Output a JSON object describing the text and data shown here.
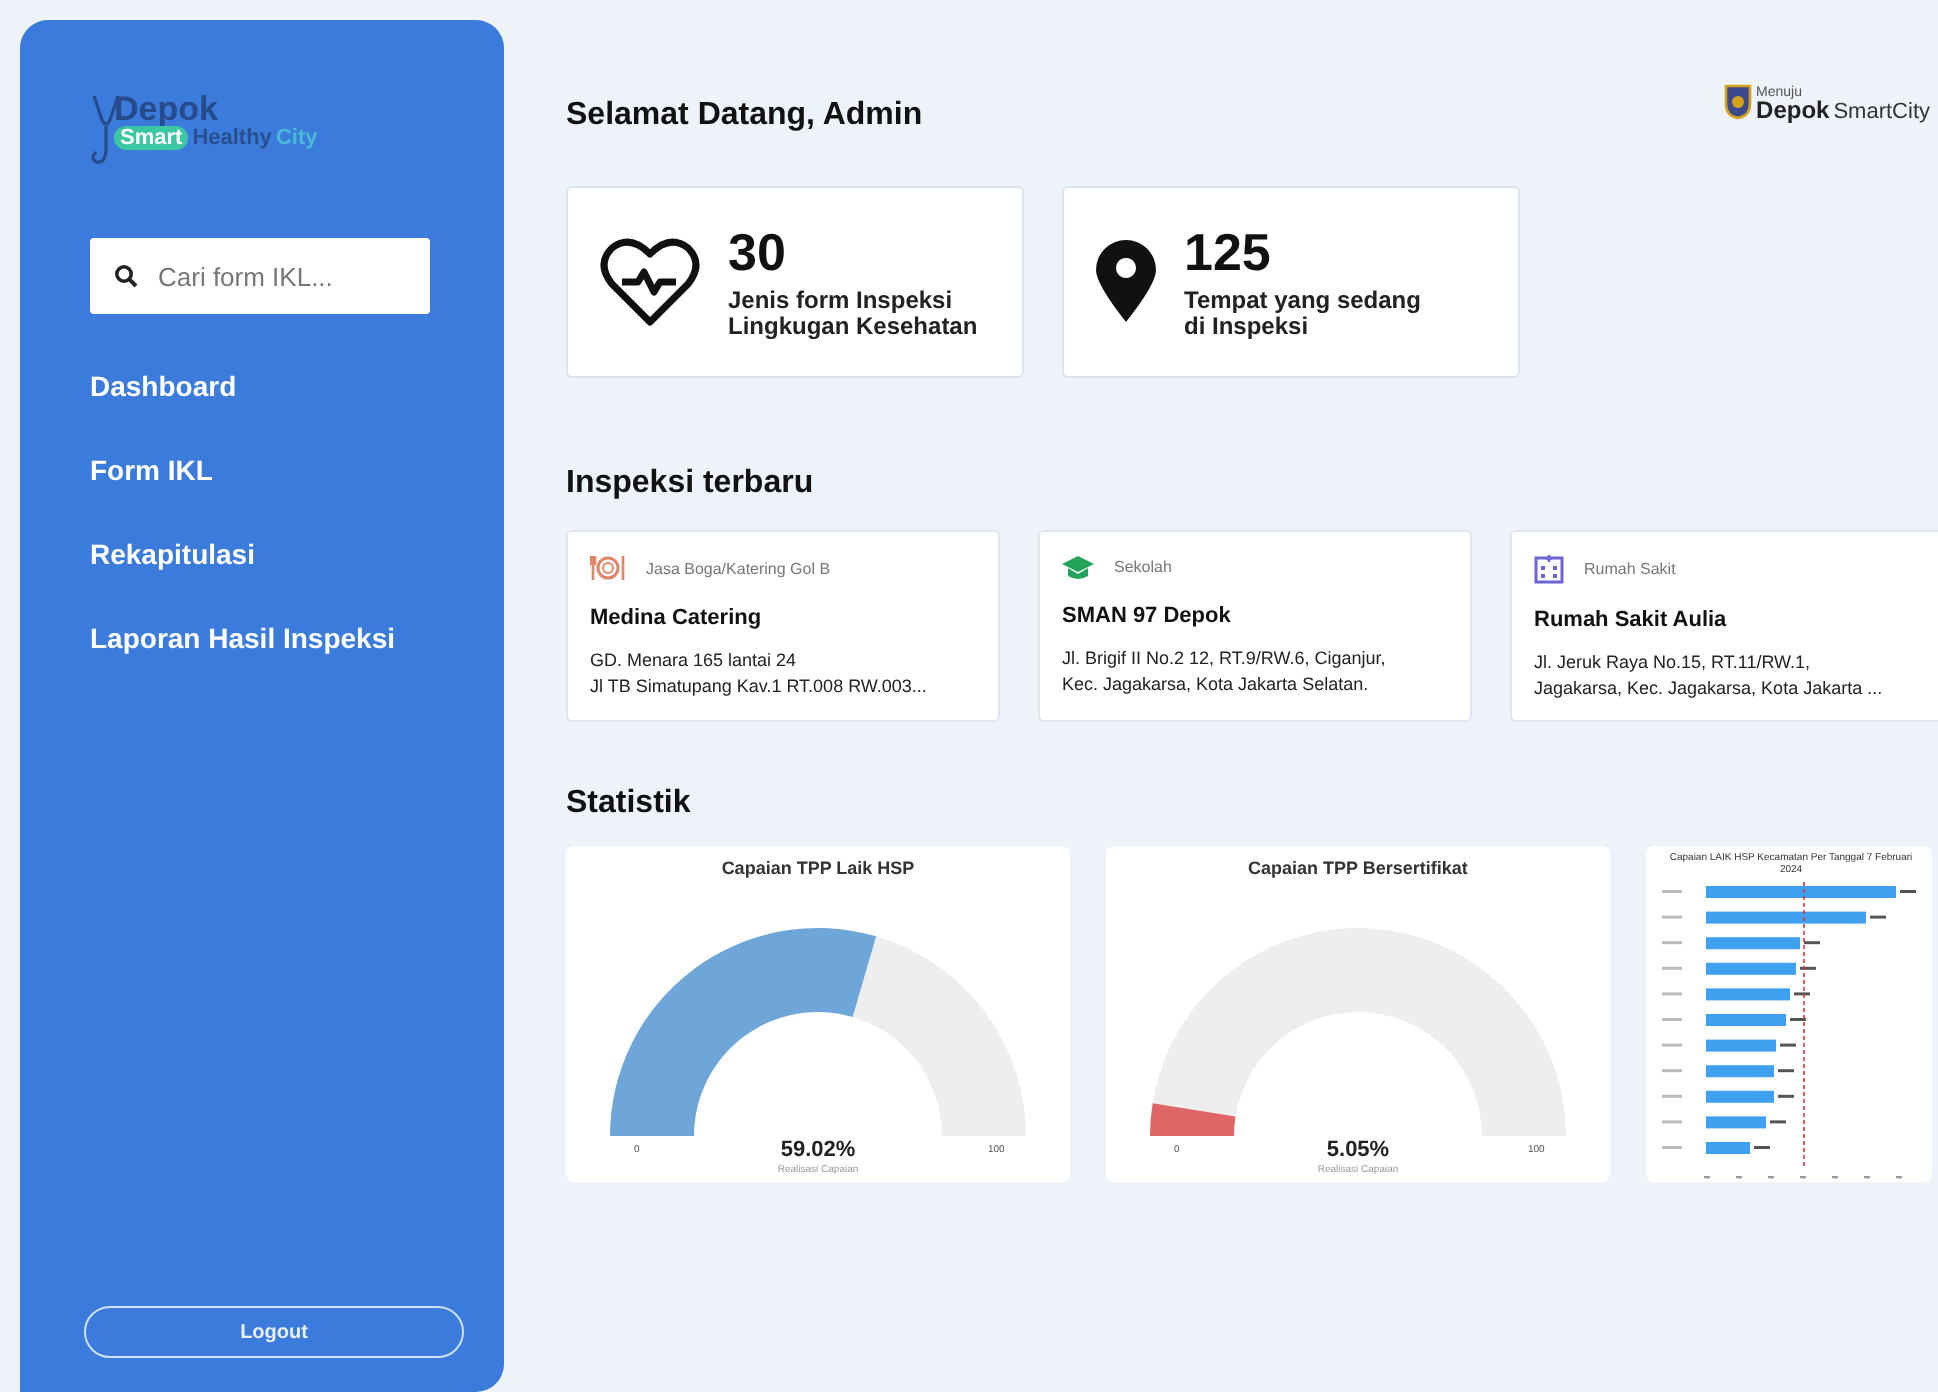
{
  "sidebar": {
    "logo": {
      "word_1": "Depok",
      "word_2": "Smart",
      "word_3": "Healthy",
      "word_4": "City"
    },
    "search": {
      "placeholder": "Cari form IKL..."
    },
    "nav_items": [
      {
        "label": "Dashboard"
      },
      {
        "label": "Form IKL"
      },
      {
        "label": "Rekapitulasi"
      },
      {
        "label": "Laporan Hasil Inspeksi"
      }
    ],
    "logout": "Logout"
  },
  "header": {
    "greeting": "Selamat Datang, Admin",
    "brand": {
      "prefix": "Menuju",
      "name": "Depok",
      "suffix": "SmartCity"
    }
  },
  "summary_cards": [
    {
      "kind": "heart",
      "value": "30",
      "label": "Jenis form Inspeksi\nLingkugan Kesehatan"
    },
    {
      "kind": "pin",
      "value": "125",
      "label": "Tempat yang sedang\ndi Inspeksi"
    }
  ],
  "latest": {
    "title": "Inspeksi terbaru",
    "items": [
      {
        "kind": "catering",
        "category": "Jasa Boga/Katering Gol B",
        "name": "Medina Catering",
        "address": "GD. Menara 165 lantai 24\nJl TB Simatupang Kav.1 RT.008 RW.003..."
      },
      {
        "kind": "school",
        "category": "Sekolah",
        "name": "SMAN 97 Depok",
        "address": "Jl. Brigif II No.2 12, RT.9/RW.6, Ciganjur,\nKec. Jagakarsa, Kota Jakarta Selatan."
      },
      {
        "kind": "hospital",
        "category": "Rumah Sakit",
        "name": "Rumah Sakit Aulia",
        "address": "Jl. Jeruk Raya No.15, RT.11/RW.1,\nJagakarsa, Kec. Jagakarsa, Kota Jakarta ..."
      }
    ]
  },
  "statistics": {
    "title": "Statistik",
    "gauges": [
      {
        "title": "Capaian TPP Laik HSP",
        "color": "#6ea6da",
        "min": "0",
        "max": "100",
        "reading": "59.02%",
        "caption": "Realisasi Capaian"
      },
      {
        "title": "Capaian TPP Bersertifikat",
        "color": "#e06666",
        "min": "0",
        "max": "100",
        "reading": "5.05%",
        "caption": "Realisasi Capaian"
      }
    ],
    "bar_panel": {
      "title": "Capaian LAIK HSP Kecamatan Per Tanggal 7 Februari 2024"
    }
  }
}
